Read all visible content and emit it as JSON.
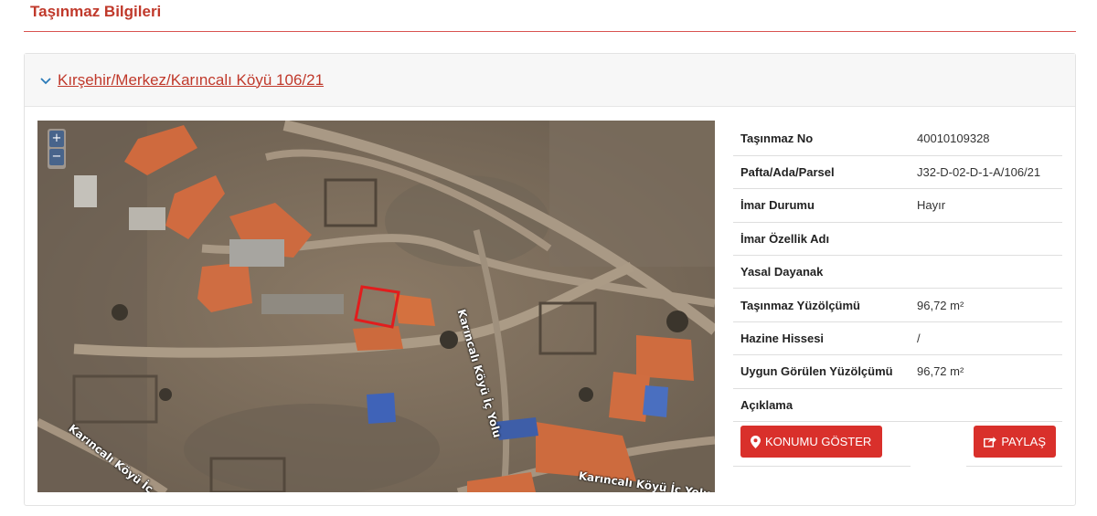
{
  "page": {
    "title": "Taşınmaz Bilgileri"
  },
  "panel": {
    "link_text": "Kırşehir/Merkez/Karıncalı Köyü 106/21"
  },
  "map": {
    "zoom_in": "+",
    "zoom_out": "−",
    "road_labels": [
      "Karıncalı Köyü İç Yolu",
      "Karıncalı Köyü İç Yolu",
      "Karıncalı Köyü İç"
    ]
  },
  "details": {
    "rows": [
      {
        "label": "Taşınmaz No",
        "value": "40010109328"
      },
      {
        "label": "Pafta/Ada/Parsel",
        "value": "J32-D-02-D-1-A/106/21"
      },
      {
        "label": "İmar Durumu",
        "value": "Hayır"
      },
      {
        "label": "İmar Özellik Adı",
        "value": ""
      },
      {
        "label": "Yasal Dayanak",
        "value": ""
      },
      {
        "label": "Taşınmaz Yüzölçümü",
        "value": "96,72 m²"
      },
      {
        "label": "Hazine Hissesi",
        "value": "/"
      },
      {
        "label": "Uygun Görülen Yüzölçümü",
        "value": "96,72 m²"
      },
      {
        "label": "Açıklama",
        "value": ""
      }
    ]
  },
  "actions": {
    "show_location": "KONUMU GÖSTER",
    "share": "PAYLAŞ"
  },
  "colors": {
    "accent": "#c0392b",
    "button": "#d9302b",
    "parcel_outline": "#e11d1d"
  },
  "icons": {
    "header_chevron": "chevron-down-icon",
    "location": "map-marker-icon",
    "share": "share-icon"
  }
}
